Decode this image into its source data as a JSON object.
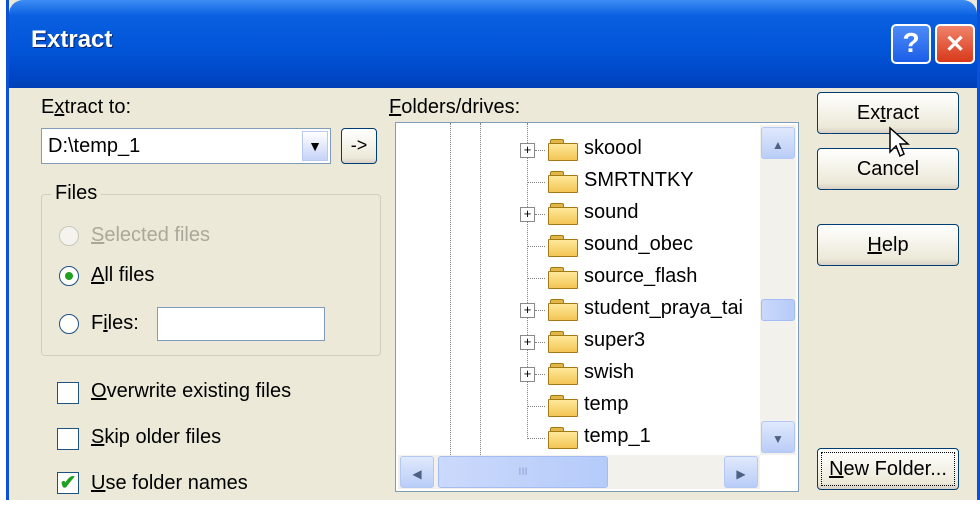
{
  "window": {
    "title": "Extract",
    "help_glyph": "?",
    "close_glyph": "✕"
  },
  "extract_to": {
    "label_pre": "E",
    "label_acc": "x",
    "label_post": "tract to:",
    "value": "D:\\temp_1",
    "drop_glyph": "▼",
    "arrow_button": "->"
  },
  "files_group": {
    "label": "Files",
    "selected_files": {
      "pre": "",
      "acc": "S",
      "post": "elected files",
      "checked": false,
      "enabled": false
    },
    "all_files": {
      "pre": "",
      "acc": "A",
      "post": "ll files",
      "checked": true
    },
    "files": {
      "pre": "F",
      "acc": "i",
      "post": "les:",
      "checked": false,
      "value": ""
    }
  },
  "options": [
    {
      "pre": "",
      "acc": "O",
      "post": "verwrite existing files",
      "checked": false
    },
    {
      "pre": "",
      "acc": "S",
      "post": "kip older files",
      "checked": false
    },
    {
      "pre": "",
      "acc": "U",
      "post": "se folder names",
      "checked": true
    }
  ],
  "folders": {
    "label_pre": "",
    "label_acc": "F",
    "label_post": "olders/drives:",
    "items": [
      {
        "name": "skoool",
        "expandable": true
      },
      {
        "name": "SMRTNTKY",
        "expandable": false
      },
      {
        "name": "sound",
        "expandable": true
      },
      {
        "name": "sound_obec",
        "expandable": false
      },
      {
        "name": "source_flash",
        "expandable": false
      },
      {
        "name": "student_praya_tai",
        "expandable": true
      },
      {
        "name": "super3",
        "expandable": true
      },
      {
        "name": "swish",
        "expandable": true
      },
      {
        "name": "temp",
        "expandable": false
      },
      {
        "name": "temp_1",
        "expandable": false
      }
    ],
    "expander_glyph": "+",
    "scroll_up": "▲",
    "scroll_down": "▼",
    "scroll_left": "◀",
    "scroll_right": "▶",
    "thumb_grip": "III"
  },
  "buttons": {
    "extract": {
      "pre": "Ex",
      "acc": "t",
      "post": "ract"
    },
    "cancel": "Cancel",
    "help": {
      "pre": "",
      "acc": "H",
      "post": "elp"
    },
    "new_folder": {
      "pre": "",
      "acc": "N",
      "post": "ew Folder..."
    }
  }
}
